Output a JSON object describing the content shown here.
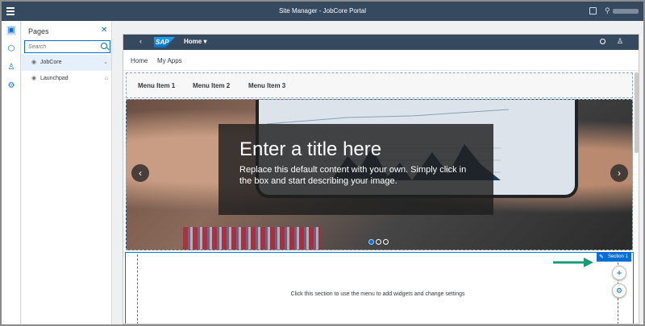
{
  "shell": {
    "title": "Site Manager - JobCore Portal",
    "menu_icon": "hamburger-icon",
    "external_icon": "external-link-icon",
    "user_icon": "user-icon"
  },
  "rail": {
    "icons": [
      "pages-icon",
      "theme-icon",
      "roles-icon",
      "settings-icon"
    ]
  },
  "pages_panel": {
    "title": "Pages",
    "close_glyph": "✕",
    "search_placeholder": "Search",
    "items": [
      {
        "label": "JobCore",
        "icon": "eye-icon",
        "trail": "⌄",
        "selected": true
      },
      {
        "label": "Launchpad",
        "icon": "eye-icon",
        "trail": "⌂",
        "selected": false
      }
    ]
  },
  "site": {
    "shellbar": {
      "back_glyph": "‹",
      "logo": "SAP",
      "home_label": "Home ▾"
    },
    "tabs": [
      "Home",
      "My Apps"
    ],
    "menu_items": [
      "Menu Item 1",
      "Menu Item 2",
      "Menu Item 3"
    ],
    "hero": {
      "title": "Enter a title here",
      "description": "Replace this default content with your own. Simply click in the box and start describing your image.",
      "prev_glyph": "‹",
      "next_glyph": "›",
      "slide_count": 3,
      "active_slide": 1
    },
    "section": {
      "tag": "Section 1",
      "message": "Click this section to use the menu to add widgets and change settings",
      "add_glyph": "+",
      "settings_glyph": "⚙"
    }
  },
  "colors": {
    "shell": "#354a5f",
    "accent": "#0a6ed1",
    "annotation_arrow": "#1a9a74"
  }
}
